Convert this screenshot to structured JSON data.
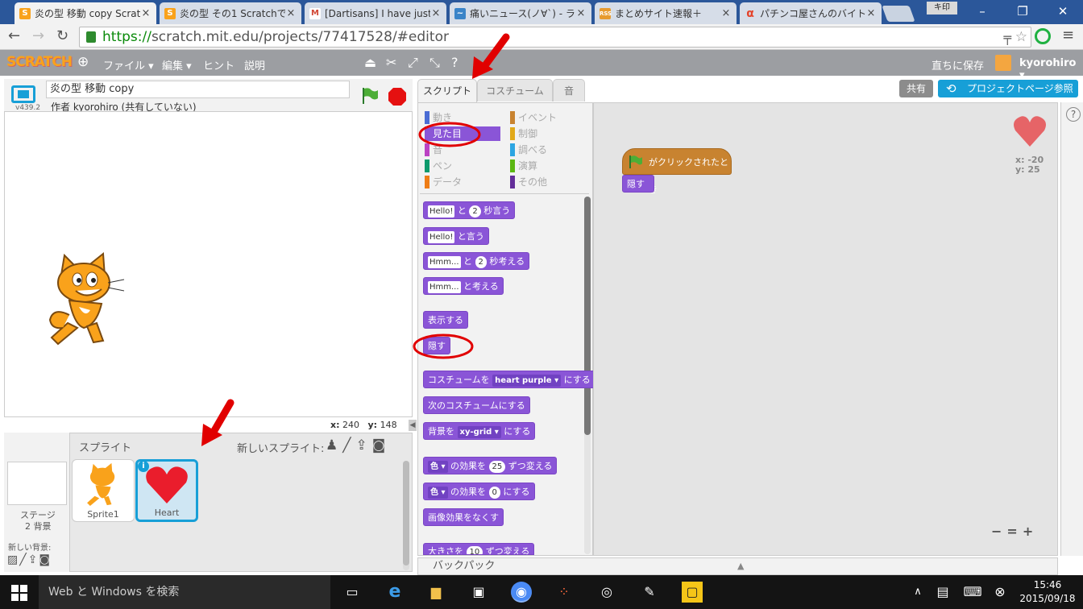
{
  "browser": {
    "tabs": [
      {
        "title": "炎の型 移動 copy Scrat",
        "icon": "scratch-favicon",
        "color": "#f9a21b",
        "active": true
      },
      {
        "title": "炎の型 その1 Scratchで",
        "icon": "scratch-favicon",
        "color": "#f9a21b",
        "active": false
      },
      {
        "title": "[Dartisans] I have just",
        "icon": "gmail-favicon",
        "color": "#d14836",
        "active": false
      },
      {
        "title": "痛いニュース(ノ∀`) - ライ",
        "icon": "news-favicon",
        "color": "#3a84c8",
        "active": false
      },
      {
        "title": "まとめサイト速報＋",
        "icon": "rss-favicon",
        "color": "#e79b2f",
        "active": false
      },
      {
        "title": "パチンコ屋さんのバイト楽",
        "icon": "alpha-favicon",
        "color": "#e4432a",
        "active": false
      }
    ],
    "close_glyph": "×",
    "ime_label": "キ印",
    "url_scheme": "https://",
    "url_rest": "scratch.mit.edu/projects/77417528/#editor"
  },
  "menubar": {
    "logo": "SCRATCH",
    "file": "ファイル ▾",
    "edit": "編集 ▾",
    "hint": "ヒント",
    "about": "説明",
    "save_now": "直ちに保存",
    "username": "kyorohiro ▾"
  },
  "stage": {
    "project_title": "炎の型 移動 copy",
    "author": "作者 kyorohiro (共有していない)",
    "version": "v439.2",
    "x_label": "x:",
    "x_value": "240",
    "y_label": "y:",
    "y_value": "148"
  },
  "sprites": {
    "header": "スプライト",
    "new_sprite": "新しいスプライト:",
    "stage_label": "ステージ",
    "stage_backdrops": "2 背景",
    "new_backdrop": "新しい背景:",
    "items": [
      {
        "name": "Sprite1",
        "selected": false
      },
      {
        "name": "Heart",
        "selected": true
      }
    ],
    "info_glyph": "i"
  },
  "editor_tabs": [
    "スクリプト",
    "コスチューム",
    "音"
  ],
  "share_button": "共有",
  "project_page_button": "プロジェクトページ参照",
  "categories": {
    "left": [
      {
        "label": "動き",
        "color": "#4a6cd4"
      },
      {
        "label": "見た目",
        "color": "#8a55d7"
      },
      {
        "label": "音",
        "color": "#bb42c3"
      },
      {
        "label": "ペン",
        "color": "#0e9a6c"
      },
      {
        "label": "データ",
        "color": "#ee7d16"
      }
    ],
    "right": [
      {
        "label": "イベント",
        "color": "#c88330"
      },
      {
        "label": "制御",
        "color": "#e1a91a"
      },
      {
        "label": "調べる",
        "color": "#2ca5e2"
      },
      {
        "label": "演算",
        "color": "#5cb712"
      },
      {
        "label": "その他",
        "color": "#632d99"
      }
    ]
  },
  "blocks": {
    "say_secs": {
      "input": "Hello!",
      "mid": "と",
      "num": "2",
      "tail": "秒言う"
    },
    "say": {
      "input": "Hello!",
      "tail": "と言う"
    },
    "think_secs": {
      "input": "Hmm...",
      "mid": "と",
      "num": "2",
      "tail": "秒考える"
    },
    "think": {
      "input": "Hmm...",
      "tail": "と考える"
    },
    "show": "表示する",
    "hide": "隠す",
    "switch_costume": {
      "head": "コスチュームを",
      "dd": "heart purple ▾",
      "tail": "にする"
    },
    "next_costume": "次のコスチュームにする",
    "switch_backdrop": {
      "head": "背景を",
      "dd": "xy-grid ▾",
      "tail": "にする"
    },
    "change_effect": {
      "dd": "色 ▾",
      "mid": "の効果を",
      "num": "25",
      "tail": "ずつ変える"
    },
    "set_effect": {
      "dd": "色 ▾",
      "mid": "の効果を",
      "num": "0",
      "tail": "にする"
    },
    "clear_effects": "画像効果をなくす",
    "change_size": {
      "head": "大きさを",
      "num": "10",
      "tail": "ずつ変える"
    }
  },
  "script": {
    "hat": "がクリックされたとき",
    "hide": "隠す"
  },
  "sprite_info": {
    "x": "x: -20",
    "y": "y: 25"
  },
  "backpack": "バックパック",
  "zoom": {
    "out": "−",
    "reset": "=",
    "in": "+"
  },
  "help_glyph": "?",
  "taskbar": {
    "search": "Web と Windows を検索",
    "time": "15:46",
    "date": "2015/09/18"
  }
}
